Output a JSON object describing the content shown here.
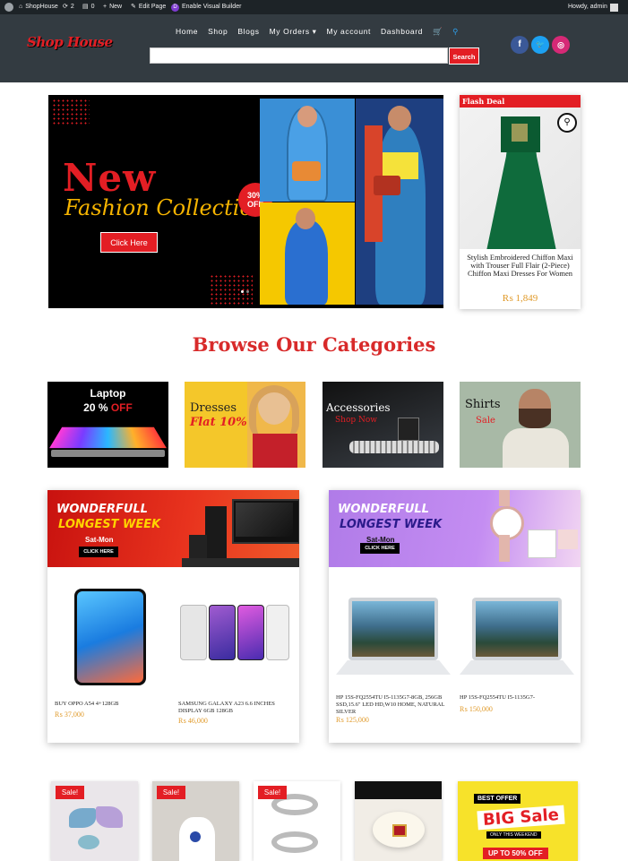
{
  "admin_bar": {
    "site_name": "ShopHouse",
    "updates_count": "2",
    "comments_count": "0",
    "new_label": "New",
    "edit_page_label": "Edit Page",
    "visual_builder_label": "Enable Visual Builder",
    "greeting": "Howdy, admin"
  },
  "header": {
    "logo_text": "Shop House",
    "nav": [
      "Home",
      "Shop",
      "Blogs",
      "My Orders",
      "My account",
      "Dashboard"
    ],
    "search_placeholder": "",
    "search_button": "Search",
    "social": [
      "f",
      "t",
      "ig"
    ]
  },
  "hero": {
    "title_line1": "New",
    "title_line2": "Fashion Collection",
    "badge_pct": "30%",
    "badge_off": "OFF",
    "cta": "Click Here"
  },
  "flash_deal": {
    "label": "Flash Deal",
    "product_name": "Stylish Embroidered Chiffon Maxi with Trouser Full Flair (2-Piece) Chiffon Maxi Dresses For Women",
    "price": "₨ 1,849"
  },
  "categories": {
    "title": "Browse Our Categories",
    "items": [
      {
        "title": "Laptop",
        "subtitle_a": "20 %",
        "subtitle_b": "OFF"
      },
      {
        "title": "Dresses",
        "subtitle": "Flat 10%"
      },
      {
        "title": "Accessories",
        "subtitle": "Shop Now"
      },
      {
        "title": "Shirts",
        "subtitle": "Sale"
      }
    ]
  },
  "promos": [
    {
      "line1": "WONDERFULL",
      "line2": "LONGEST WEEK",
      "days": "Sat-Mon",
      "button": "CLICK HERE",
      "products": [
        {
          "name": "BUY OPPO A54 4+128GB",
          "price": "₨ 37,000"
        },
        {
          "name": "SAMSUNG GALAXY A23 6.6 INCHES DISPLAY 6GB 128GB",
          "price": "₨ 46,000"
        }
      ]
    },
    {
      "line1": "WONDERFULL",
      "line2": "LONGEST WEEK",
      "days": "Sat-Mon",
      "button": "CLICK HERE",
      "products": [
        {
          "name": "HP 15S-FQ2554TU I5-1135G7-8GB, 256GB SSD,15.6\" LED HD,W10 HOME, NATURAL SILVER",
          "price": "₨ 125,000"
        },
        {
          "name": "HP 15S-FQ2554TU I5-1135G7-",
          "price": "₨ 150,000"
        }
      ]
    }
  ],
  "bottom_products": {
    "sale_label": "Sale!",
    "best_offer": "BEST OFFER",
    "big_sale": "BIG Sale",
    "weekend": "ONLY THIS WEEKEND",
    "upto": "UP TO 50% OFF"
  },
  "colors": {
    "accent": "#e31e24",
    "header_bg": "#333b41",
    "admin_bg": "#1d2327",
    "price": "#e09a2a"
  }
}
